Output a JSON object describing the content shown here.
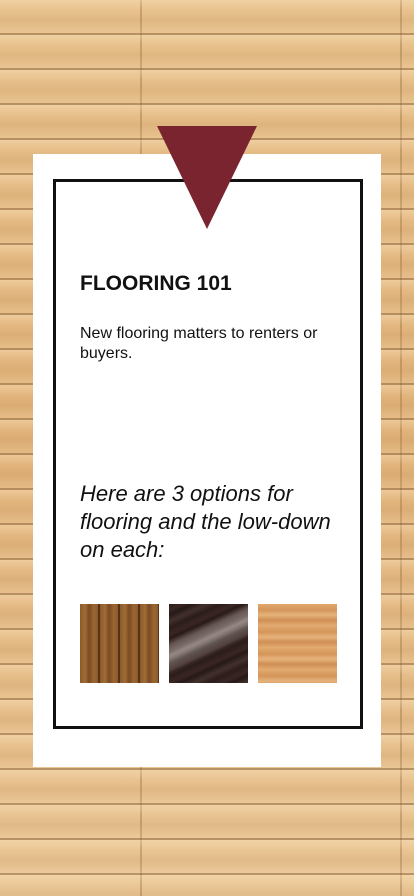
{
  "card": {
    "title": "FLOORING 101",
    "intro": "New flooring matters to renters or buyers.",
    "options_text": "Here are 3 options for flooring and the low-down on each:"
  },
  "swatches": [
    {
      "name": "hand-scraped-wood-floor-swatch"
    },
    {
      "name": "dark-polished-wood-floor-swatch"
    },
    {
      "name": "light-oak-floor-swatch"
    }
  ],
  "colors": {
    "accent": "#7a2430",
    "background_wood": "#e7bf8a",
    "card": "#ffffff",
    "border": "#111111"
  }
}
